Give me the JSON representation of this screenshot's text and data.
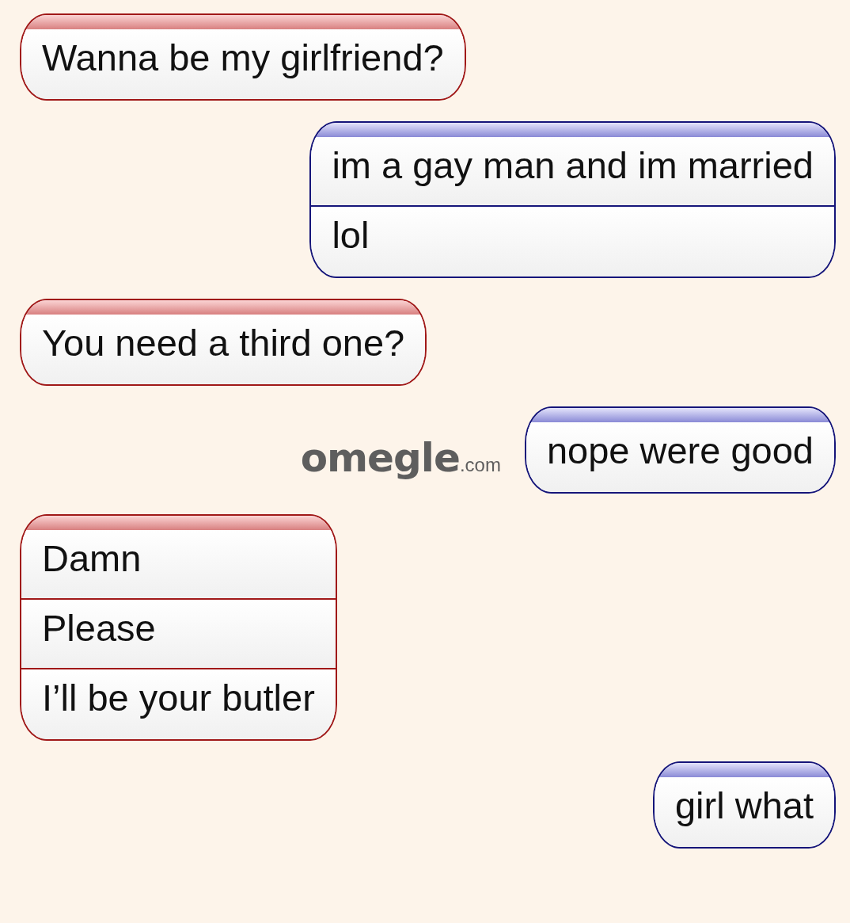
{
  "messages": [
    {
      "kind": "stranger",
      "lines": [
        "Wanna be my girlfriend?"
      ]
    },
    {
      "kind": "you",
      "lines": [
        "im a gay man and im married",
        "lol"
      ]
    },
    {
      "kind": "stranger",
      "lines": [
        "You need a third one?"
      ]
    },
    {
      "kind": "you",
      "lines": [
        "nope were good"
      ],
      "logo": {
        "name": "omegle",
        "suffix": ".com"
      }
    },
    {
      "kind": "stranger",
      "lines": [
        "Damn",
        "Please",
        "I’ll be your butler"
      ]
    },
    {
      "kind": "you",
      "lines": [
        "girl what"
      ]
    }
  ]
}
